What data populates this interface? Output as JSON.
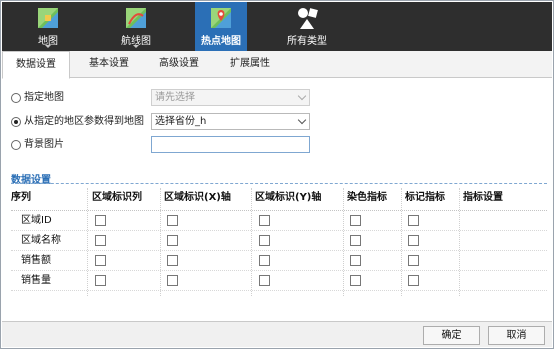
{
  "chart_types": [
    {
      "label": "地图",
      "icon": "map-icon",
      "selected": false
    },
    {
      "label": "航线图",
      "icon": "route-map-icon",
      "selected": false
    },
    {
      "label": "热点地图",
      "icon": "heat-map-icon",
      "selected": true
    },
    {
      "label": "所有类型",
      "icon": "all-types-icon",
      "selected": false
    }
  ],
  "tabs": [
    {
      "label": "数据设置",
      "active": true
    },
    {
      "label": "基本设置",
      "active": false
    },
    {
      "label": "高级设置",
      "active": false
    },
    {
      "label": "扩展属性",
      "active": false
    }
  ],
  "options": {
    "specified_map": {
      "label": "指定地图",
      "selected": false,
      "select_placeholder": "请先选择"
    },
    "from_region_param": {
      "label": "从指定的地区参数得到地图",
      "selected": true,
      "select_value": "选择省份_h"
    },
    "background_image": {
      "label": "背景图片",
      "selected": false,
      "value": ""
    }
  },
  "section": {
    "title": "数据设置"
  },
  "grid": {
    "headers": [
      "序列",
      "区域标识列",
      "区域标识(X)轴",
      "区域标识(Y)轴",
      "染色指标",
      "标记指标",
      "指标设置"
    ],
    "rows": [
      {
        "label": "区域ID",
        "checks": [
          false,
          false,
          false,
          false,
          false
        ]
      },
      {
        "label": "区域名称",
        "checks": [
          false,
          false,
          false,
          false,
          false
        ]
      },
      {
        "label": "销售额",
        "checks": [
          false,
          false,
          false,
          false,
          false
        ]
      },
      {
        "label": "销售量",
        "checks": [
          false,
          false,
          false,
          false,
          false
        ]
      }
    ]
  },
  "footer": {
    "ok_label": "确定",
    "cancel_label": "取消"
  },
  "colors": {
    "accent": "#2b6fb6",
    "toolbar_bg": "#2e2e2e"
  }
}
